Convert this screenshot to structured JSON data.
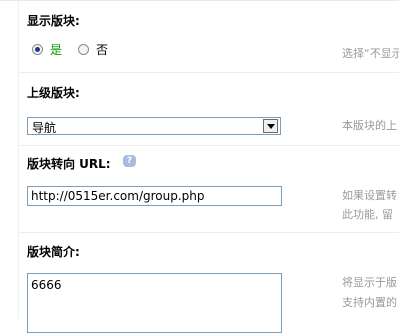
{
  "show_section": {
    "label": "显示版块:",
    "options": [
      {
        "label": "是",
        "selected": true,
        "color": "#009900"
      },
      {
        "label": "否",
        "selected": false,
        "color": "#000000"
      }
    ],
    "hint": "选择“不显示"
  },
  "parent_section": {
    "label": "上级版块:",
    "selected_value": "导航",
    "hint": "本版块的上"
  },
  "redirect_url": {
    "label": "版块转向 URL:",
    "help_icon": "?",
    "value": "http://0515er.com/group.php",
    "hint_lines": [
      "如果设置转",
      "此功能, 留"
    ]
  },
  "section_intro": {
    "label": "版块简介:",
    "value": "6666",
    "hint_lines": [
      "将显示于版",
      "支持内置的"
    ]
  }
}
